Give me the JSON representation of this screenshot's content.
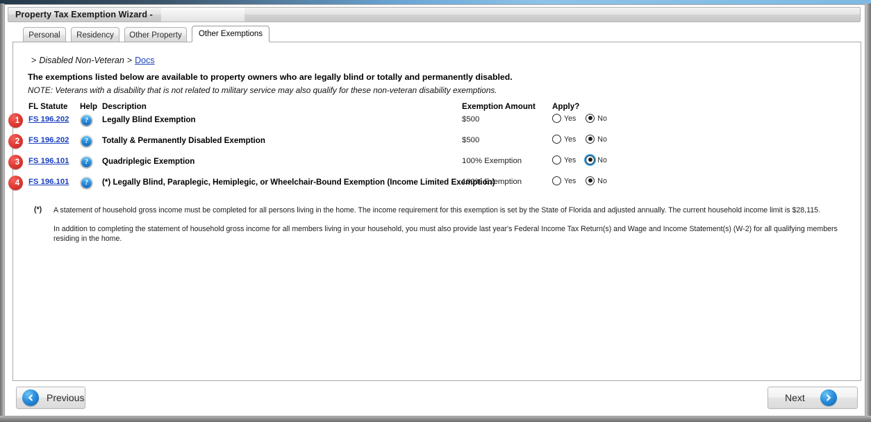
{
  "window": {
    "title": "Property Tax Exemption Wizard -"
  },
  "tabs": [
    {
      "label": "Personal",
      "active": false
    },
    {
      "label": "Residency",
      "active": false
    },
    {
      "label": "Other Property",
      "active": false
    },
    {
      "label": "Other Exemptions",
      "active": true
    }
  ],
  "breadcrumb": {
    "lead_separator": ">",
    "current": "Disabled Non-Veteran",
    "separator": ">",
    "link": "Docs"
  },
  "intro": {
    "headline": "The exemptions listed below are available to property owners who are legally blind or totally and permanently disabled.",
    "note": "NOTE: Veterans with a disability that is not related to military service may also qualify for these non-veteran disability exemptions."
  },
  "table": {
    "headers": {
      "statute": "FL Statute",
      "help": "Help",
      "description": "Description",
      "amount": "Exemption Amount",
      "apply": "Apply?"
    },
    "yes_label": "Yes",
    "no_label": "No",
    "rows": [
      {
        "badge": "1",
        "statute": "FS 196.202",
        "help_icon": "help-question-icon",
        "description": "Legally Blind Exemption",
        "amount": "$500",
        "apply": "No",
        "focused": false
      },
      {
        "badge": "2",
        "statute": "FS 196.202",
        "help_icon": "help-question-icon",
        "description": "Totally & Permanently Disabled Exemption",
        "amount": "$500",
        "apply": "No",
        "focused": false
      },
      {
        "badge": "3",
        "statute": "FS 196.101",
        "help_icon": "help-question-icon",
        "description": "Quadriplegic Exemption",
        "amount": "100% Exemption",
        "apply": "No",
        "focused": true
      },
      {
        "badge": "4",
        "statute": "FS 196.101",
        "help_icon": "help-question-icon",
        "description": "(*) Legally Blind, Paraplegic, Hemiplegic, or Wheelchair-Bound Exemption (Income Limited Exemption)",
        "amount": "100% Exemption",
        "apply": "No",
        "focused": false
      }
    ]
  },
  "footnotes": {
    "mark": "(*)",
    "first": "A statement of household gross income must be completed for all persons living in the home. The income requirement for this exemption is set by the State of Florida and adjusted annually. The current household income limit is $28,115.",
    "second": "In addition to completing the statement of household gross income for all members living in your household, you must also provide last year's Federal Income Tax Return(s) and Wage and Income Statement(s) (W-2) for all qualifying members residing in the home."
  },
  "footer": {
    "previous_label": "Previous",
    "previous_icon": "arrow-left-icon",
    "next_label": "Next",
    "next_icon": "arrow-right-icon"
  },
  "colors": {
    "link": "#1a3fbe",
    "badge_red": "#e03b35",
    "accent_blue": "#2b8fdd",
    "focus_ring": "#2fa2e8"
  }
}
